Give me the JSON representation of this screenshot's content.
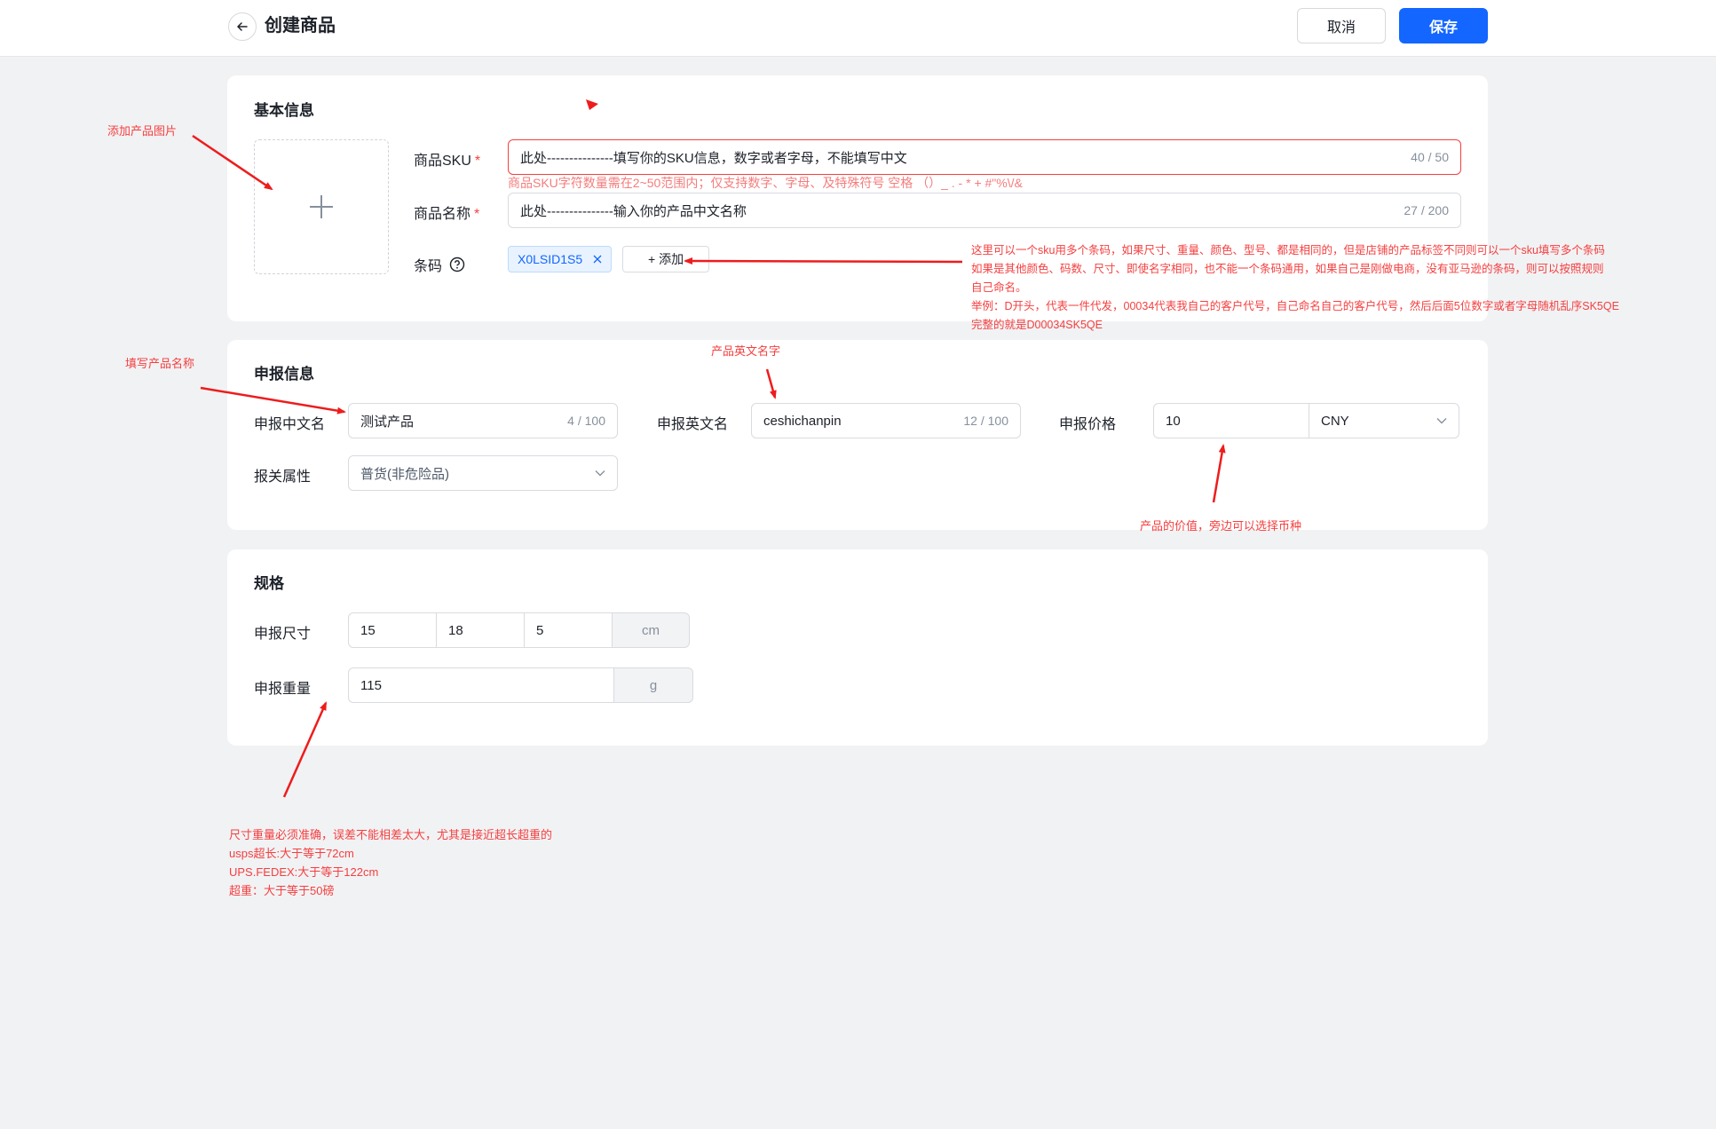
{
  "header": {
    "title": "创建商品",
    "cancel_label": "取消",
    "save_label": "保存"
  },
  "basic": {
    "title": "基本信息",
    "sku": {
      "label": "商品SKU",
      "required": "*",
      "value": "此处---------------填写你的SKU信息，数字或者字母，不能填写中文",
      "count": "40 / 50",
      "error": "商品SKU字符数量需在2~50范围内；仅支持数字、字母、及特殊符号 空格 （）_ . - * + #\"%\\/&"
    },
    "name": {
      "label": "商品名称",
      "required": "*",
      "value": "此处---------------输入你的产品中文名称",
      "count": "27 / 200"
    },
    "barcode": {
      "label": "条码",
      "tag": "X0LSID1S5",
      "add_label": "+ 添加"
    }
  },
  "declare": {
    "title": "申报信息",
    "cn_name": {
      "label": "申报中文名",
      "value": "测试产品",
      "count": "4 / 100"
    },
    "en_name": {
      "label": "申报英文名",
      "value": "ceshichanpin",
      "count": "12 / 100"
    },
    "price": {
      "label": "申报价格",
      "value": "10",
      "currency": "CNY"
    },
    "customs": {
      "label": "报关属性",
      "value": "普货(非危险品)"
    }
  },
  "spec": {
    "title": "规格",
    "size": {
      "label": "申报尺寸",
      "length": "15",
      "width": "18",
      "height": "5",
      "unit": "cm"
    },
    "weight": {
      "label": "申报重量",
      "value": "115",
      "unit": "g"
    }
  },
  "annotations": {
    "add_image": "添加产品图片",
    "fill_name": "填写产品名称",
    "en_name": "产品英文名字",
    "price": "产品的价值，旁边可以选择币种",
    "barcode_lines": [
      "这里可以一个sku用多个条码，如果尺寸、重量、颜色、型号、都是相同的，但是店铺的产品标签不同则可以一个sku填写多个条码",
      "如果是其他颜色、码数、尺寸、即使名字相同，也不能一个条码通用，如果自己是刚做电商，没有亚马逊的条码，则可以按照规则",
      "自己命名。",
      "举例：D开头，代表一件代发，00034代表我自己的客户代号，自己命名自己的客户代号，然后后面5位数字或者字母随机乱序SK5QE",
      "完整的就是D00034SK5QE"
    ],
    "spec_lines": [
      "尺寸重量必须准确，误差不能相差太大，尤其是接近超长超重的",
      "usps超长:大于等于72cm",
      "UPS.FEDEX:大于等于122cm",
      "超重：大于等于50磅"
    ]
  },
  "colors": {
    "primary": "#1366ff",
    "error": "#f53f3f",
    "annotation": "#ee1c1c"
  }
}
